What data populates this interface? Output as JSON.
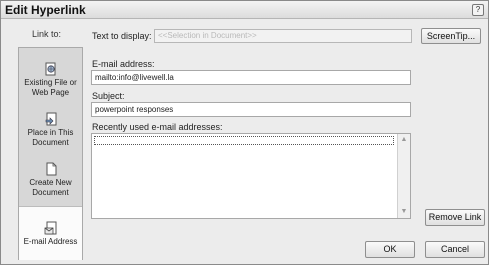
{
  "dialog": {
    "title": "Edit Hyperlink",
    "help_icon": "?"
  },
  "sidebar": {
    "heading": "Link to:",
    "items": [
      {
        "label": "Existing File or Web Page",
        "icon": "globe-file-icon"
      },
      {
        "label": "Place in This Document",
        "icon": "place-document-icon"
      },
      {
        "label": "Create New Document",
        "icon": "new-document-icon"
      },
      {
        "label": "E-mail Address",
        "icon": "email-document-icon",
        "selected": true
      }
    ]
  },
  "form": {
    "display_label": "Text to display:",
    "display_value": "<<Selection in Document>>",
    "screentip_label": "ScreenTip...",
    "email_label": "E-mail address:",
    "email_value": "mailto:info@livewell.la",
    "subject_label": "Subject:",
    "subject_value": "powerpoint responses",
    "recent_label": "Recently used e-mail addresses:",
    "remove_link_label": "Remove Link",
    "ok_label": "OK",
    "cancel_label": "Cancel",
    "scroll_up": "▲",
    "scroll_down": "▼"
  }
}
